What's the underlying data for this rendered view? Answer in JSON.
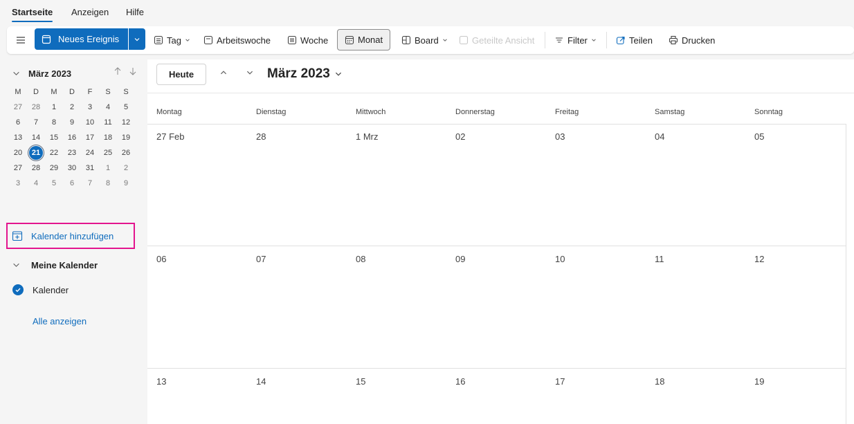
{
  "menu": {
    "tabs": [
      "Startseite",
      "Anzeigen",
      "Hilfe"
    ]
  },
  "toolbar": {
    "new_event": "Neues Ereignis",
    "tag": "Tag",
    "arbeitswoche": "Arbeitswoche",
    "woche": "Woche",
    "monat": "Monat",
    "board": "Board",
    "geteilte_ansicht": "Geteilte Ansicht",
    "filter": "Filter",
    "teilen": "Teilen",
    "drucken": "Drucken"
  },
  "mini_calendar": {
    "title": "März 2023",
    "weekday_heads": [
      "M",
      "D",
      "M",
      "D",
      "F",
      "S",
      "S"
    ],
    "weeks": [
      [
        "27",
        "28",
        "1",
        "2",
        "3",
        "4",
        "5"
      ],
      [
        "6",
        "7",
        "8",
        "9",
        "10",
        "11",
        "12"
      ],
      [
        "13",
        "14",
        "15",
        "16",
        "17",
        "18",
        "19"
      ],
      [
        "20",
        "21",
        "22",
        "23",
        "24",
        "25",
        "26"
      ],
      [
        "27",
        "28",
        "29",
        "30",
        "31",
        "1",
        "2"
      ],
      [
        "3",
        "4",
        "5",
        "6",
        "7",
        "8",
        "9"
      ]
    ],
    "today": "21"
  },
  "sidebar": {
    "add_calendar": "Kalender hinzufügen",
    "my_calendars": "Meine Kalender",
    "calendar_item": "Kalender",
    "show_all": "Alle anzeigen"
  },
  "calendar": {
    "today_button": "Heute",
    "month_title": "März 2023",
    "weekdays": [
      "Montag",
      "Dienstag",
      "Mittwoch",
      "Donnerstag",
      "Freitag",
      "Samstag",
      "Sonntag"
    ],
    "weeks": [
      [
        "27 Feb",
        "28",
        "1 Mrz",
        "02",
        "03",
        "04",
        "05"
      ],
      [
        "06",
        "07",
        "08",
        "09",
        "10",
        "11",
        "12"
      ],
      [
        "13",
        "14",
        "15",
        "16",
        "17",
        "18",
        "19"
      ]
    ]
  },
  "colors": {
    "accent": "#0f6cbd",
    "highlight": "#e3148e"
  }
}
